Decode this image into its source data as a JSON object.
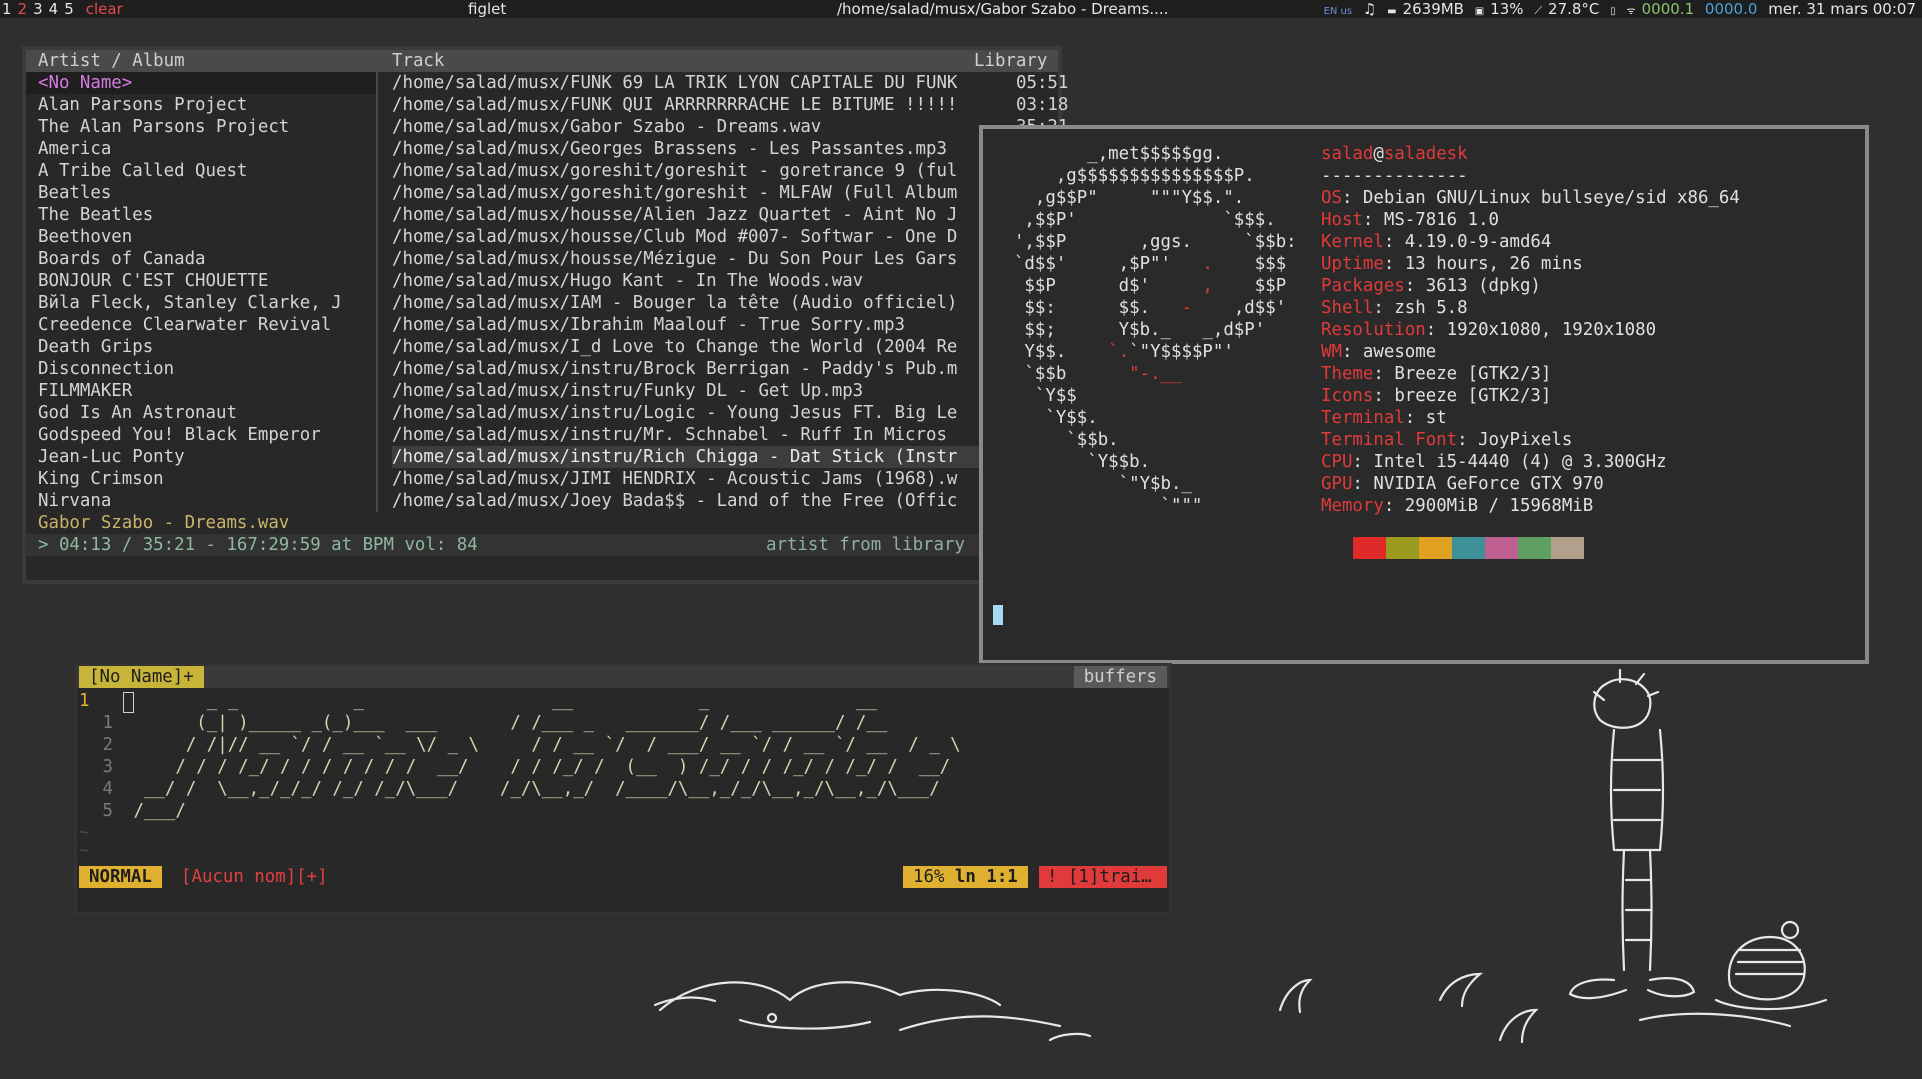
{
  "topbar": {
    "tags": [
      "1",
      "2",
      "3",
      "4",
      "5"
    ],
    "clear_label": "clear",
    "task_label": "figlet",
    "window_title": "/home/salad/musx/Gabor Szabo - Dreams....",
    "kb_layout": "EN us",
    "memory": "2639MB",
    "cpu": "13%",
    "temp": "27.8°C",
    "net_up": "0000.1",
    "net_down": "0000.0",
    "clock": "mer. 31 mars 00:07"
  },
  "cmus": {
    "headers": {
      "artist": "Artist / Album",
      "track": "Track",
      "library": "Library"
    },
    "artists": [
      "<No Name>",
      "Alan Parsons Project",
      "The Alan Parsons Project",
      "America",
      "A Tribe Called Quest",
      "Beatles",
      "The Beatles",
      "Beethoven",
      "Boards of Canada",
      "BONJOUR C'EST CHOUETTE",
      "Bйla Fleck, Stanley Clarke, J",
      "Creedence Clearwater Revival",
      "Death Grips",
      "Disconnection",
      "FILMMAKER",
      "God Is An Astronaut",
      "Godspeed You! Black Emperor",
      "Jean-Luc Ponty",
      "King Crimson",
      "Nirvana"
    ],
    "tracks": [
      {
        "path": "/home/salad/musx/FUNK 69 LA TRIK LYON CAPITALE DU FUNK",
        "dur": "05:51"
      },
      {
        "path": "/home/salad/musx/FUNK QUI ARRRRRRRACHE LE BITUME !!!!!",
        "dur": "03:18"
      },
      {
        "path": "/home/salad/musx/Gabor Szabo - Dreams.wav",
        "dur": "35:21"
      },
      {
        "path": "/home/salad/musx/Georges Brassens - Les Passantes.mp3",
        "dur": ""
      },
      {
        "path": "/home/salad/musx/goreshit/goreshit - goretrance 9 (ful",
        "dur": ""
      },
      {
        "path": "/home/salad/musx/goreshit/goreshit - MLFAW (Full Album",
        "dur": ""
      },
      {
        "path": "/home/salad/musx/housse/Alien Jazz Quartet - Aint No J",
        "dur": ""
      },
      {
        "path": "/home/salad/musx/housse/Club Mod #007- Softwar - One D",
        "dur": ""
      },
      {
        "path": "/home/salad/musx/housse/Mézigue - Du Son Pour Les Gars",
        "dur": ""
      },
      {
        "path": "/home/salad/musx/Hugo Kant - In The Woods.wav",
        "dur": ""
      },
      {
        "path": "/home/salad/musx/IAM - Bouger la tête (Audio officiel)",
        "dur": ""
      },
      {
        "path": "/home/salad/musx/Ibrahim Maalouf - True Sorry.mp3",
        "dur": ""
      },
      {
        "path": "/home/salad/musx/I_d Love to Change the World (2004 Re",
        "dur": ""
      },
      {
        "path": "/home/salad/musx/instru/Brock Berrigan - Paddy's Pub.m",
        "dur": ""
      },
      {
        "path": "/home/salad/musx/instru/Funky DL - Get Up.mp3",
        "dur": ""
      },
      {
        "path": "/home/salad/musx/instru/Logic - Young Jesus FT. Big Le",
        "dur": ""
      },
      {
        "path": "/home/salad/musx/instru/Mr. Schnabel - Ruff In Micros",
        "dur": ""
      },
      {
        "path": "/home/salad/musx/instru/Rich Chigga - Dat Stick (Instr",
        "dur": ""
      },
      {
        "path": "/home/salad/musx/JIMI HENDRIX - Acoustic Jams (1968).w",
        "dur": ""
      },
      {
        "path": "/home/salad/musx/Joey Bada$$ - Land of the Free (Offic",
        "dur": ""
      }
    ],
    "now_playing": "Gabor Szabo - Dreams.wav",
    "status": "> 04:13 / 35:21 - 167:29:59 at  BPM vol: 84",
    "status_right": "artist from library"
  },
  "neofetch": {
    "user": "salad",
    "at": "@",
    "host": "saladesk",
    "divider": "--------------",
    "fields": [
      {
        "key": "OS",
        "value": "Debian GNU/Linux bullseye/sid x86_64"
      },
      {
        "key": "Host",
        "value": "MS-7816 1.0"
      },
      {
        "key": "Kernel",
        "value": "4.19.0-9-amd64"
      },
      {
        "key": "Uptime",
        "value": "13 hours, 26 mins"
      },
      {
        "key": "Packages",
        "value": "3613 (dpkg)"
      },
      {
        "key": "Shell",
        "value": "zsh 5.8"
      },
      {
        "key": "Resolution",
        "value": "1920x1080, 1920x1080"
      },
      {
        "key": "WM",
        "value": "awesome"
      },
      {
        "key": "Theme",
        "value": "Breeze [GTK2/3]"
      },
      {
        "key": "Icons",
        "value": "breeze [GTK2/3]"
      },
      {
        "key": "Terminal",
        "value": "st"
      },
      {
        "key": "Terminal Font",
        "value": "JoyPixels"
      },
      {
        "key": "CPU",
        "value": "Intel i5-4440 (4) @ 3.300GHz"
      },
      {
        "key": "GPU",
        "value": "NVIDIA GeForce GTX 970"
      },
      {
        "key": "Memory",
        "value": "2900MiB / 15968MiB"
      }
    ],
    "palette": [
      "#e02a2a",
      "#9a9a1e",
      "#e0a020",
      "#3d8f98",
      "#c06090",
      "#5fa060",
      "#b0a08c"
    ]
  },
  "vim": {
    "tab_label": "[No Name]+",
    "buffers_label": "buffers",
    "line_numbers": [
      "1",
      "2",
      "3",
      "4",
      "5"
    ],
    "current_line": "1",
    "mode": "NORMAL",
    "filename": "[Aucun nom][+]",
    "position_percent": "16%",
    "position_ln": "ln",
    "position_rc": "1:1",
    "warning": "! [1]trai…"
  },
  "colors": {
    "accent_red": "#e03a3a",
    "accent_yellow": "#e0b030",
    "background": "#2f2f2f"
  }
}
